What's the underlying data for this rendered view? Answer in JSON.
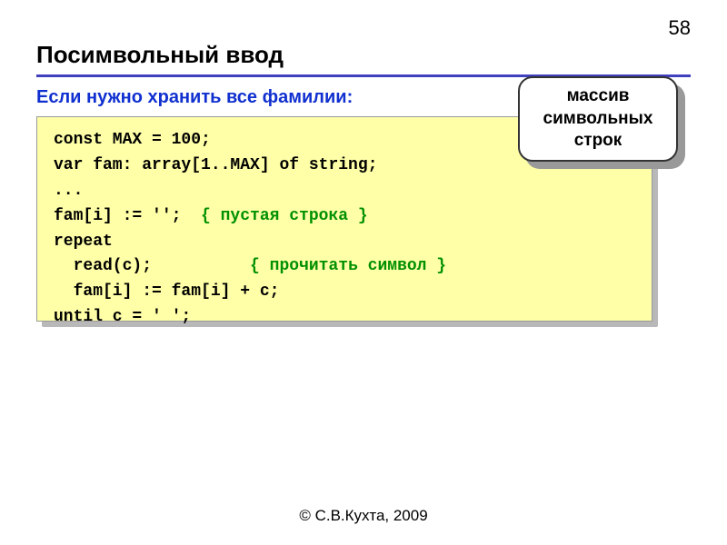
{
  "page_number": "58",
  "title": "Посимвольный ввод",
  "subtitle": "Если нужно хранить все фамилии:",
  "code": {
    "l1": "const MAX = 100;",
    "l2": "var fam: array[1..MAX] of string;",
    "l3": "...",
    "l4a": "fam[i] := '';  ",
    "l4b": "{ пустая строка }",
    "l5": "repeat",
    "l6a": "  read(c);          ",
    "l6b": "{ прочитать символ }",
    "l7": "  fam[i] := fam[i] + c;",
    "l8": "until c = ' ';"
  },
  "callout": "массив символьных строк",
  "footer": "© С.В.Кухта, 2009"
}
